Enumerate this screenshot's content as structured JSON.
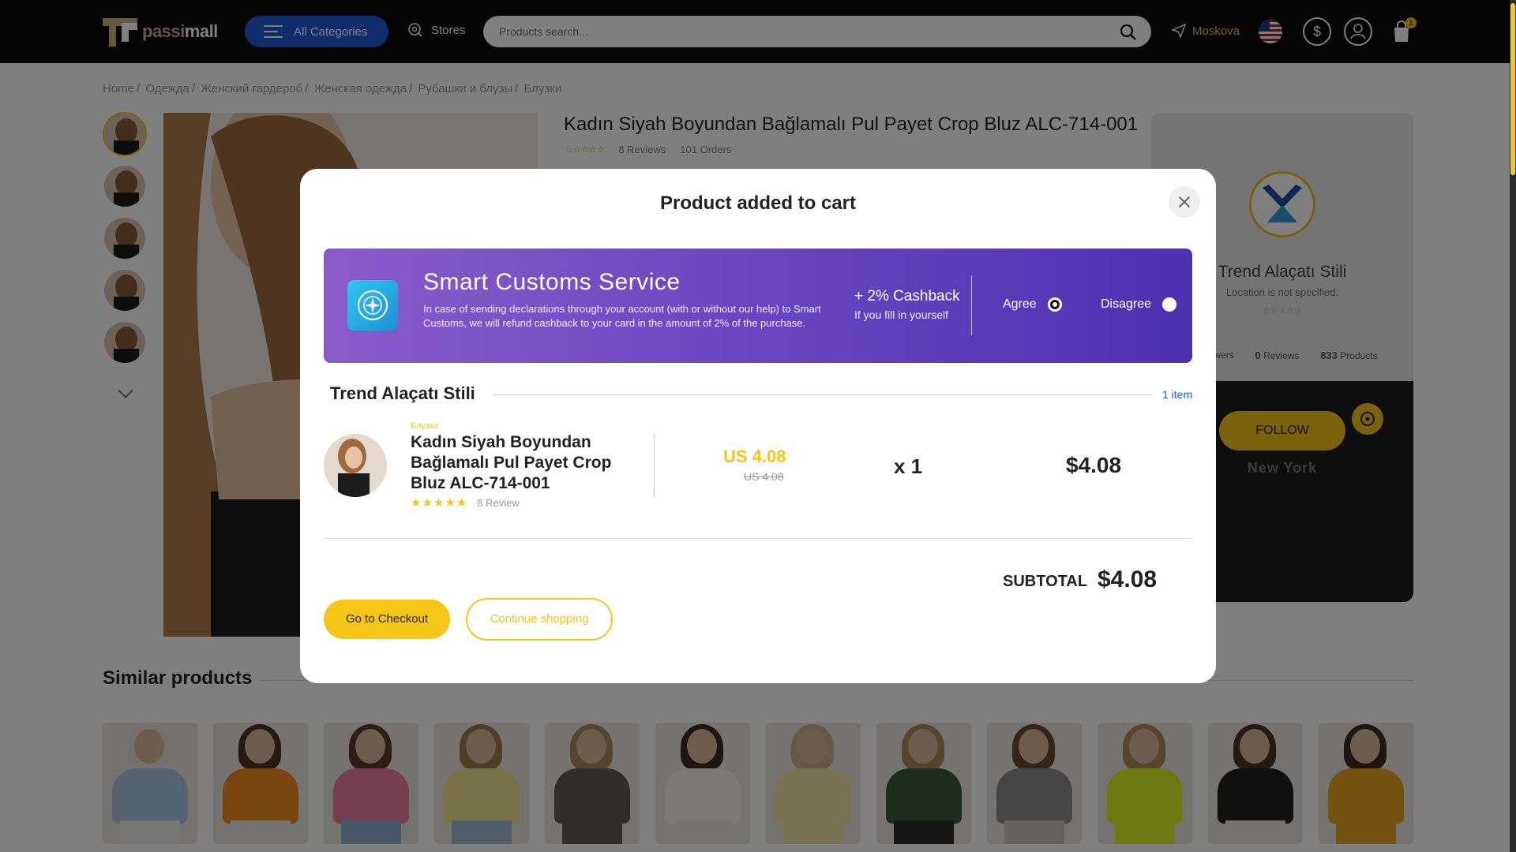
{
  "header": {
    "logo_part1": "passi",
    "logo_part2": "mall",
    "categories_label": "All Categories",
    "stores_label": "Stores",
    "search_placeholder": "Products search...",
    "location": "Moskova",
    "cart_count": "1"
  },
  "breadcrumb": [
    "Home",
    "Одежда",
    "Женский гардероб",
    "Женская одежда",
    "Рубашки и блузы",
    "Блузки"
  ],
  "product": {
    "title": "Kadın Siyah Boyundan Bağlamalı Pul Payet Crop Bluz ALC-714-001",
    "stars": "☆☆☆☆☆",
    "reviews": "8 Reviews",
    "orders": "101 Orders"
  },
  "store": {
    "name": "Trend Alaçatı Stili",
    "location": "Location is not specified.",
    "stars": "☆☆☆☆☆",
    "followers_label": "Followers",
    "reviews_count": "0",
    "reviews_label": "Reviews",
    "products_count": "833",
    "products_label": "Products",
    "follow_label": "FOLLOW",
    "city": "New York"
  },
  "similar": {
    "title": "Similar products",
    "items": [
      {
        "top": "#a9c9e6",
        "hair": "#e8e1d8",
        "bottom": "#eeeeee"
      },
      {
        "top": "#f08a1e",
        "hair": "#4a3222",
        "bottom": "#e9e6e1"
      },
      {
        "top": "#e87aa0",
        "hair": "#5a3b28",
        "bottom": "#8fb0d0"
      },
      {
        "top": "#f2e58c",
        "hair": "#9c7a4e",
        "bottom": "#9fbad6"
      },
      {
        "top": "#5c5a52",
        "hair": "#a88a5a",
        "bottom": "#5c5a52"
      },
      {
        "top": "#f4f2f0",
        "hair": "#3a2a22",
        "bottom": "#e9e6e1"
      },
      {
        "top": "#f2e6a6",
        "hair": "#c9b28c",
        "bottom": "#f2e6a6"
      },
      {
        "top": "#3b5a3a",
        "hair": "#a88a5a",
        "bottom": "#2a2a2a"
      },
      {
        "top": "#8a8a8a",
        "hair": "#6b4a32",
        "bottom": "#c8c4be"
      },
      {
        "top": "#d6f220",
        "hair": "#b08a5a",
        "bottom": "#d6f220"
      },
      {
        "top": "#1e1e1e",
        "hair": "#4a3222",
        "bottom": "#e9e6e1"
      },
      {
        "top": "#e8a41e",
        "hair": "#3a2a22",
        "bottom": "#e8a41e"
      }
    ]
  },
  "modal": {
    "title": "Product added to cart",
    "customs": {
      "title": "Smart Customs Service",
      "description": "In case of sending declarations through your account (with or without our help) to Smart Customs, we will refund cashback to your card in the amount of 2% of the purchase.",
      "cashback": "+ 2% Cashback",
      "cashback_sub": "If you fill in yourself",
      "agree_label": "Agree",
      "disagree_label": "Disagree",
      "selected": "agree"
    },
    "seller": "Trend Alaçatı Stili",
    "item_count": "1 item",
    "item": {
      "category": "Блузки",
      "name": "Kadın Siyah Boyundan Bağlamalı Pul Payet Crop Bluz ALC-714-001",
      "stars": "★★★★★",
      "reviews": "8 Review",
      "price": "US 4.08",
      "old_price": "US 4.08",
      "quantity": "x 1",
      "total": "$4.08"
    },
    "subtotal_label": "SUBTOTAL",
    "subtotal_value": "$4.08",
    "checkout_label": "Go to Checkout",
    "continue_label": "Continue shopping"
  },
  "colors": {
    "accent": "#f5c518",
    "primary_blue": "#1f5bd6",
    "customs_gradient_start": "#8a5cc9",
    "customs_gradient_end": "#4e31b0"
  }
}
